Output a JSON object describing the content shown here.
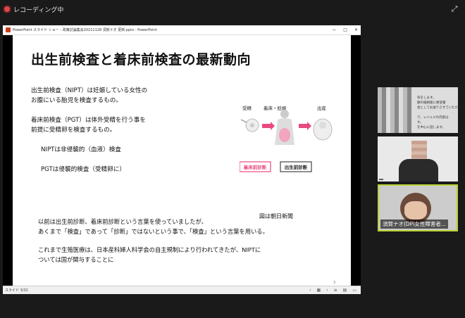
{
  "recording": {
    "label": "レコーディング中"
  },
  "powerpoint": {
    "window_title": "PowerPoint スライド ショー  -  政策討論集会20211128 須賀ナオ 更新.pptx - PowerPoint",
    "window_buttons": [
      "ー",
      "□",
      "✕"
    ],
    "slide": {
      "title": "出生前検査と着床前検査の最新動向",
      "p1": "出生前検査（NIPT）は妊娠している女性の\nお腹にいる胎児を検査するもの。",
      "p2": "着床前検査（PGT）は体外受精を行う事を\n前提に受精卵を検査するもの。",
      "p3": "NIPTは非侵襲的（血液）検査",
      "p4": "PGTは侵襲的検査（受精卵に）",
      "figure_labels": {
        "fert": "受精",
        "bed": "着床・妊娠",
        "birth": "出産",
        "pre_implant": "着床前診断",
        "prenatal": "出生前診断"
      },
      "caption": "図は朝日新聞",
      "p5": "以前は出生前診断、着床前診断という言葉を使っていましたが、\nあくまで「検査」であって「診断」ではないという事で、「検査」という言葉を用いる。",
      "p6": "これまで生殖医療は、日本産科婦人科学会の自主規制により行われてきたが、NIPTに\nついては国が関与することに",
      "page_number": "3"
    },
    "status": {
      "slide_counter": "スライド 3/32"
    }
  },
  "participants": [
    {
      "caption": "有をします。\n題の縮刷版に要望書\n会としてお送りさせていただ\n\nで、レジュメの内容は\nす。\nを中心に話します。"
    },
    {
      "name": ""
    },
    {
      "name": "須賀ナオ(DPI女性障害者..."
    }
  ]
}
